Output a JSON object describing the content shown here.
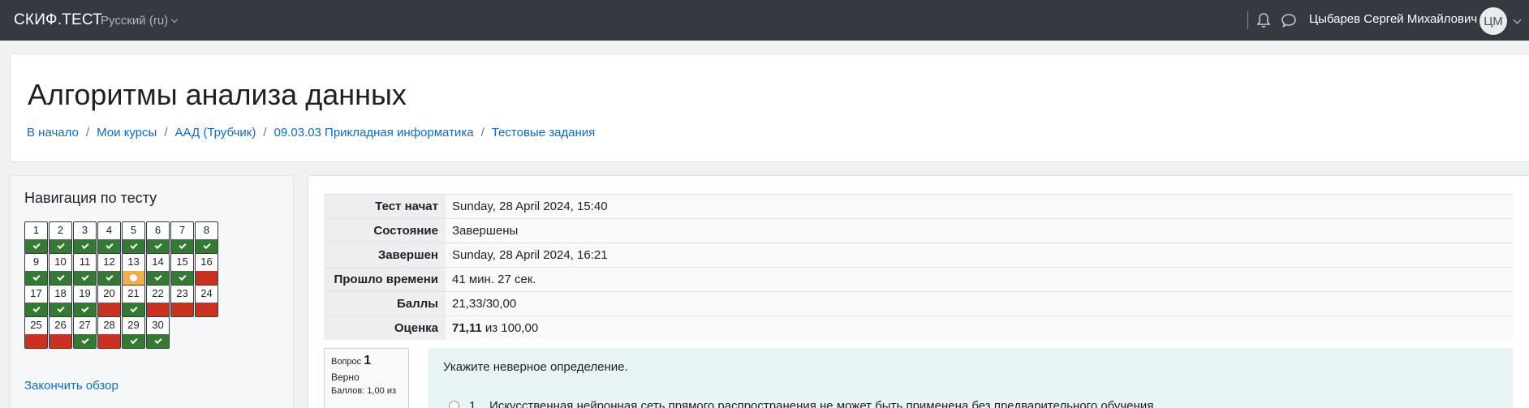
{
  "topbar": {
    "brand": "СКИФ.ТЕСТ",
    "language": "Русский (ru)",
    "user_name": "Цыбарев Сергей Михайлович",
    "avatar_initials": "ЦМ"
  },
  "header": {
    "title": "Алгоритмы анализа данных",
    "breadcrumb": [
      "В начало",
      "Мои курсы",
      "ААД (Трубчик)",
      "09.03.03 Прикладная информатика",
      "Тестовые задания"
    ]
  },
  "navigation": {
    "title": "Навигация по тесту",
    "questions": [
      {
        "n": "1",
        "status": "correct"
      },
      {
        "n": "2",
        "status": "correct"
      },
      {
        "n": "3",
        "status": "correct"
      },
      {
        "n": "4",
        "status": "correct"
      },
      {
        "n": "5",
        "status": "correct"
      },
      {
        "n": "6",
        "status": "correct"
      },
      {
        "n": "7",
        "status": "correct"
      },
      {
        "n": "8",
        "status": "correct"
      },
      {
        "n": "9",
        "status": "correct"
      },
      {
        "n": "10",
        "status": "correct"
      },
      {
        "n": "11",
        "status": "correct"
      },
      {
        "n": "12",
        "status": "correct"
      },
      {
        "n": "13",
        "status": "partial"
      },
      {
        "n": "14",
        "status": "correct"
      },
      {
        "n": "15",
        "status": "correct"
      },
      {
        "n": "16",
        "status": "incorrect"
      },
      {
        "n": "17",
        "status": "correct"
      },
      {
        "n": "18",
        "status": "correct"
      },
      {
        "n": "19",
        "status": "correct"
      },
      {
        "n": "20",
        "status": "incorrect"
      },
      {
        "n": "21",
        "status": "correct"
      },
      {
        "n": "22",
        "status": "incorrect"
      },
      {
        "n": "23",
        "status": "incorrect"
      },
      {
        "n": "24",
        "status": "incorrect"
      },
      {
        "n": "25",
        "status": "incorrect"
      },
      {
        "n": "26",
        "status": "incorrect"
      },
      {
        "n": "27",
        "status": "correct"
      },
      {
        "n": "28",
        "status": "incorrect"
      },
      {
        "n": "29",
        "status": "correct"
      },
      {
        "n": "30",
        "status": "correct"
      }
    ],
    "finish_review": "Закончить обзор"
  },
  "summary": {
    "rows": [
      {
        "label": "Тест начат",
        "value": "Sunday, 28 April 2024, 15:40"
      },
      {
        "label": "Состояние",
        "value": "Завершены"
      },
      {
        "label": "Завершен",
        "value": "Sunday, 28 April 2024, 16:21"
      },
      {
        "label": "Прошло времени",
        "value": "41 мин. 27 сек."
      },
      {
        "label": "Баллы",
        "value": "21,33/30,00"
      }
    ],
    "grade_label": "Оценка",
    "grade_value": "71,11",
    "grade_suffix": " из 100,00"
  },
  "question": {
    "prefix": "Вопрос",
    "number": "1",
    "state": "Верно",
    "marks": "Баллов: 1,00 из",
    "text": "Укажите неверное определение.",
    "option_label": "1.",
    "option_text": "Искусственная нейронная сеть прямого распространения не может быть применена без предварительного обучения."
  },
  "colors": {
    "topbar": "#343a40",
    "link": "#0f6cbf",
    "correct": "#357a32",
    "incorrect": "#ca3120",
    "partial": "#f0ad4e",
    "question_bg": "#e7f3f5"
  }
}
